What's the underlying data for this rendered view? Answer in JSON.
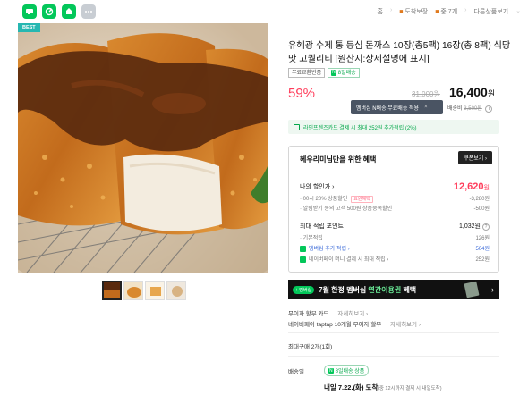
{
  "topbar": {
    "crumbs": [
      "홈",
      "도착보장",
      "중 7개",
      "다른상품보기"
    ]
  },
  "product": {
    "badge": "BEST",
    "title": "유혜광 수제 통 등심 돈까스 10장(총5팩) 16장(총 8팩) 식당맛 고퀄리티 [원산지:상세설명에 표시]",
    "tags": [
      "무료교환반품",
      "N",
      "8일배송"
    ]
  },
  "price": {
    "discount_rate": "59%",
    "original": "31,000원",
    "current": "16,400",
    "won": "원",
    "tooltip": "멤버십 N배송 무료배송 적용",
    "tooltip_close": "×",
    "shipping_label": "배송비",
    "shipping_fee": "3,500원",
    "promo": "라인프렌즈카드 결제 시 최대 252원 추가적립 (2%)"
  },
  "benefit": {
    "title": "헤우리미님만을 위한 혜택",
    "coupon_button": "쿠폰보기",
    "my_price_label": "나의 할인가",
    "my_price": "12,620",
    "my_price_won": "원",
    "discount_rows": [
      {
        "label": "00시 20% 상품할인",
        "pill": "요원혜택",
        "value": "-3,280원"
      },
      {
        "label": "알림받기 동의 고객 500원 상품중복할인",
        "pill": "",
        "value": "-500원"
      }
    ],
    "points_label": "최대 적립 포인트",
    "points_value": "1,032원",
    "points_rows": [
      {
        "label": "기본적립",
        "value": "126원"
      },
      {
        "label": "멤버십 추가 적립",
        "value": "504원"
      },
      {
        "label": "네이버페이 머니 결제 시 최대 적립",
        "value": "252원"
      }
    ]
  },
  "banner": {
    "badge": "+ 멤버십",
    "text_before": "7월 한정 멤버십 ",
    "text_highlight": "연간이용권",
    "text_after": " 혜택",
    "arrow": "›"
  },
  "info": {
    "card_label": "무이자 할부 카드",
    "card_more": "자세히보기",
    "pay_label": "네이버페이 taptap 10개월 무이자 할부",
    "pay_more": "자세히보기",
    "max_buy": "최대구매 2개(1회)",
    "delivery_label": "배송일",
    "delivery_tag": "8일배송 상품",
    "delivery_date": "내일 7.22.(화) 도착",
    "delivery_note": "(중 12시까지 결제 시 내일도착)"
  },
  "colors": {
    "naver_green": "#03c75a",
    "sale_red": "#ff3d5b",
    "best_badge": "#26b7b1"
  }
}
